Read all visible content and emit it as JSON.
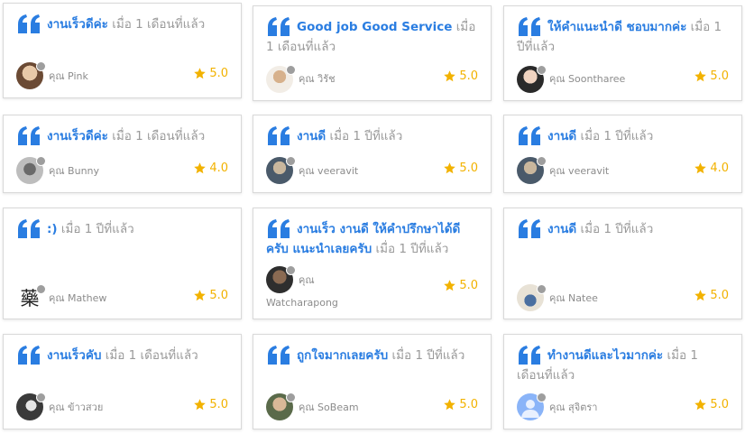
{
  "reviews": [
    {
      "title": "งานเร็วดีค่ะ",
      "time": "เมื่อ 1 เดือนที่แล้ว",
      "reviewer": "คุณ Pink",
      "rating": "5.0",
      "avatar": "avatar-pink"
    },
    {
      "title": "Good job Good Service",
      "time": "เมื่อ 1 เดือนที่แล้ว",
      "reviewer": "คุณ วิรัช",
      "rating": "5.0",
      "avatar": "avatar-wirat"
    },
    {
      "title": "ให้คำแนะนำดี ชอบมากค่ะ",
      "time": "เมื่อ 1 ปีที่แล้ว",
      "reviewer": "คุณ Soontharee",
      "rating": "5.0",
      "avatar": "avatar-soontharee"
    },
    {
      "title": "งานเร็วดีค่ะ",
      "time": "เมื่อ 1 เดือนที่แล้ว",
      "reviewer": "คุณ Bunny",
      "rating": "4.0",
      "avatar": "avatar-bunny"
    },
    {
      "title": "งานดี",
      "time": "เมื่อ 1 ปีที่แล้ว",
      "reviewer": "คุณ veeravit",
      "rating": "5.0",
      "avatar": "avatar-veeravit"
    },
    {
      "title": "งานดี",
      "time": "เมื่อ 1 ปีที่แล้ว",
      "reviewer": "คุณ veeravit",
      "rating": "4.0",
      "avatar": "avatar-veeravit"
    },
    {
      "title": ":)",
      "time": "เมื่อ 1 ปีที่แล้ว",
      "reviewer": "คุณ Mathew",
      "rating": "5.0",
      "avatar": "avatar-mathew",
      "avatar_char": "藥"
    },
    {
      "title": "งานเร็ว งานดี ให้คำปรึกษาได้ดีครับ แนะนำเลยครับ",
      "time": "เมื่อ 1 ปีที่แล้ว",
      "reviewer_prefix": "คุณ",
      "reviewer_name": "Watcharapong",
      "rating": "5.0",
      "avatar": "avatar-watcharapong"
    },
    {
      "title": "งานดี",
      "time": "เมื่อ 1 ปีที่แล้ว",
      "reviewer": "คุณ Natee",
      "rating": "5.0",
      "avatar": "avatar-natee"
    },
    {
      "title": "งานเร็วคับ",
      "time": "เมื่อ 1 เดือนที่แล้ว",
      "reviewer": "คุณ ข้าวสวย",
      "rating": "5.0",
      "avatar": "avatar-khaosuay"
    },
    {
      "title": "ถูกใจมากเลยครับ",
      "time": "เมื่อ 1 ปีที่แล้ว",
      "reviewer": "คุณ SoBeam",
      "rating": "5.0",
      "avatar": "avatar-sobeam"
    },
    {
      "title": "ทำงานดีและไวมากค่ะ",
      "time": "เมื่อ 1 เดือนที่แล้ว",
      "reviewer": "คุณ สุจิตรา",
      "rating": "5.0",
      "avatar": "avatar-sujitra"
    }
  ],
  "colors": {
    "title": "#2a7de1",
    "muted": "#9a9a9a",
    "star": "#f2b200",
    "border": "#d9d9d9"
  },
  "icons": {
    "quote": "quote-icon",
    "star": "star-icon",
    "status": "status-dot"
  }
}
